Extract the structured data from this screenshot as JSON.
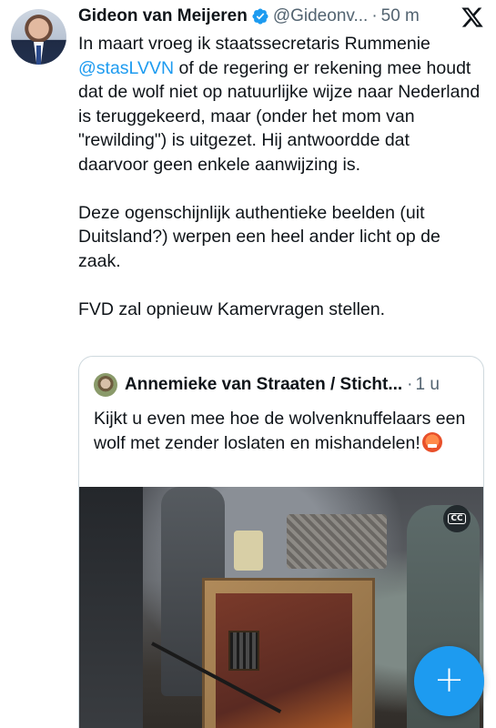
{
  "tweet": {
    "author_name": "Gideon van Meijeren",
    "author_handle": "@Gideonv...",
    "separator": "·",
    "timestamp": "50 m",
    "verified": true,
    "body": {
      "p1_prefix": "In maart vroeg ik staatssecretaris Rummenie",
      "p1_mention": "@stasLVVN",
      "p1_suffix": " of de regering er rekening mee houdt dat de wolf niet op natuurlijke wijze naar Nederland is teruggekeerd, maar (onder het mom van \"rewilding\") is uitgezet. Hij antwoordde dat daarvoor geen enkele aanwijzing is.",
      "p2": "Deze ogenschijnlijk authentieke beelden (uit Duitsland?) werpen een heel ander licht op de zaak.",
      "p3": "FVD zal opnieuw Kamervragen stellen."
    }
  },
  "quoted_tweet": {
    "author_name": "Annemieke van Straaten / Sticht...",
    "separator": "·",
    "timestamp": "1 u",
    "text": "Kijkt u even mee hoe de wolvenknuffelaars een wolf met zender loslaten en mishandelen!",
    "emoji": "angry-face-with-symbols",
    "media": {
      "type": "video",
      "captions_badge": "CC"
    }
  },
  "fab": {
    "label": "+",
    "icon": "plus-icon"
  },
  "colors": {
    "accent": "#1d9bf0",
    "text_primary": "#0f1419",
    "text_secondary": "#536471",
    "border": "#cfd9de"
  },
  "icons": [
    "verified-badge-icon",
    "x-logo-icon",
    "closed-captions-icon",
    "plus-icon"
  ]
}
